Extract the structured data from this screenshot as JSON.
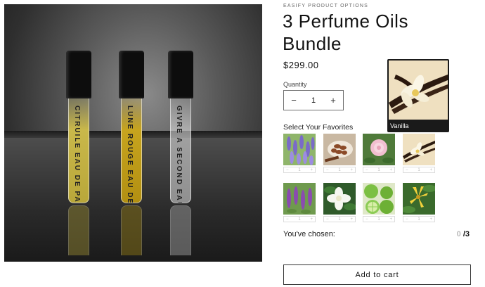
{
  "product": {
    "vendor": "EASIFY PRODUCT OPTIONS",
    "title": "3 Perfume Oils Bundle",
    "price": "$299.00"
  },
  "quantity": {
    "label": "Quantity",
    "value": "1",
    "minus": "−",
    "plus": "+"
  },
  "preview": {
    "name": "Vanilla"
  },
  "favorites": {
    "label": "Select Your Favorites",
    "items": [
      {
        "icon": "lavender-icon",
        "qty": "1"
      },
      {
        "icon": "cinnamon-icon",
        "qty": "1"
      },
      {
        "icon": "peony-icon",
        "qty": "1"
      },
      {
        "icon": "vanilla-icon",
        "qty": "1"
      },
      {
        "icon": "salvia-icon",
        "qty": "1"
      },
      {
        "icon": "gardenia-icon",
        "qty": "1"
      },
      {
        "icon": "lime-icon",
        "qty": "1"
      },
      {
        "icon": "ylang-icon",
        "qty": "1"
      }
    ],
    "step_minus": "−",
    "step_plus": "+"
  },
  "chosen": {
    "label": "You've chosen:",
    "count": "0",
    "max": "/3"
  },
  "cart": {
    "label": "Add to cart"
  },
  "vials": [
    {
      "label": "CITRUILE  EAU DE PARFUM",
      "liquid": "#c9b84a"
    },
    {
      "label": "LUNE ROUGE  EAU DE PARFUM",
      "liquid": "#c7a41e"
    },
    {
      "label": "GIVRE A SECOND  EAU DE PARFUM",
      "liquid": "#d8d8d8"
    }
  ],
  "colors": {
    "accent": "#121212",
    "muted": "#bbbbbb"
  }
}
